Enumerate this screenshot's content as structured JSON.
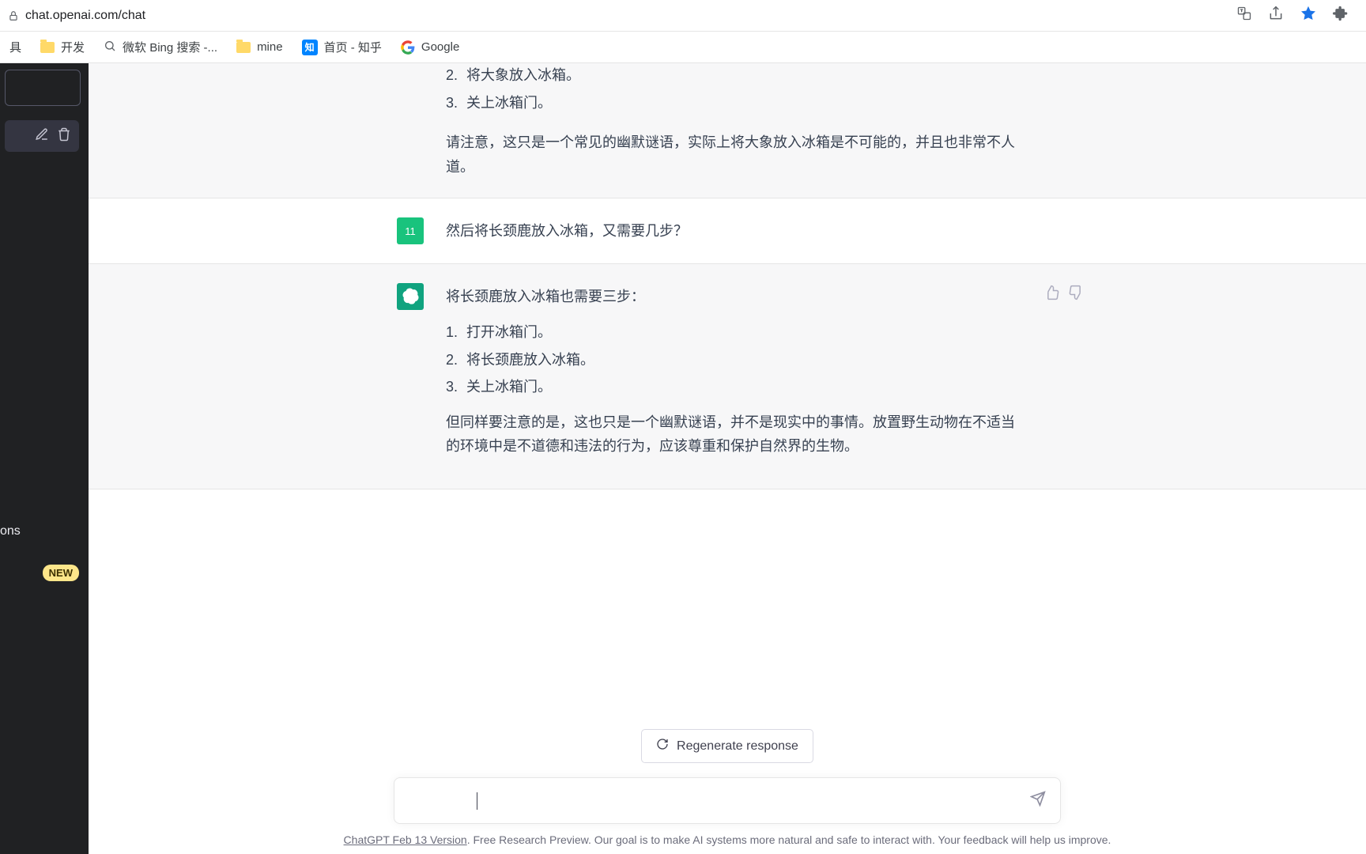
{
  "browser": {
    "url": "chat.openai.com/chat"
  },
  "bookmarks": {
    "item0_suffix": "具",
    "item1": "开发",
    "item2": "微软 Bing 搜索 -...",
    "item3": "mine",
    "item4": "首页 - 知乎",
    "item5": "Google",
    "zhihu_badge": "知"
  },
  "sidebar": {
    "ons_suffix": "ons",
    "new_badge": "NEW"
  },
  "messages": {
    "partial_prev": {
      "li2": "将大象放入冰箱。",
      "li3": "关上冰箱门。",
      "note": "请注意，这只是一个常见的幽默谜语，实际上将大象放入冰箱是不可能的，并且也非常不人道。"
    },
    "user2": {
      "avatar": "11",
      "text": "然后将长颈鹿放入冰箱，又需要几步？"
    },
    "ai2": {
      "intro": "将长颈鹿放入冰箱也需要三步：",
      "li1": "打开冰箱门。",
      "li2": "将长颈鹿放入冰箱。",
      "li3": "关上冰箱门。",
      "note": "但同样要注意的是，这也只是一个幽默谜语，并不是现实中的事情。放置野生动物在不适当的环境中是不道德和违法的行为，应该尊重和保护自然界的生物。"
    }
  },
  "composer": {
    "regenerate": "Regenerate response"
  },
  "footer": {
    "version": "ChatGPT Feb 13 Version",
    "rest": ". Free Research Preview. Our goal is to make AI systems more natural and safe to interact with. Your feedback will help us improve."
  }
}
